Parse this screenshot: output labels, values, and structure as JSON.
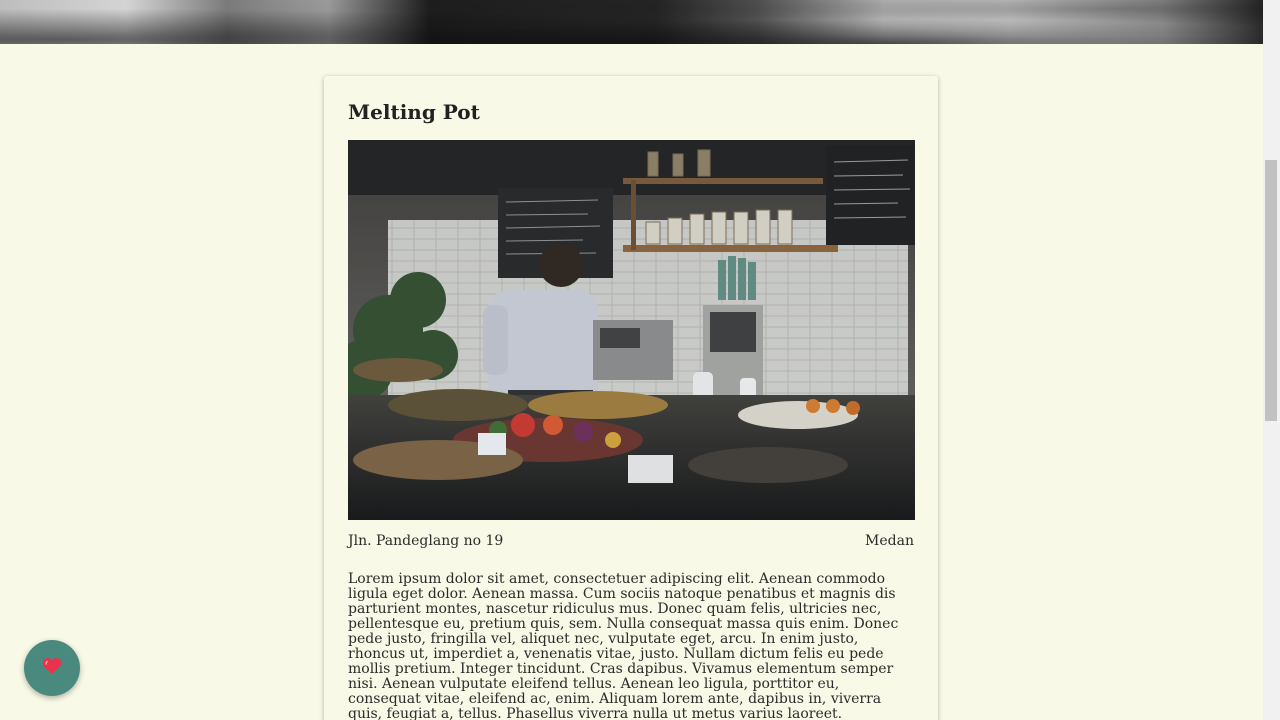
{
  "restaurant": {
    "name": "Melting Pot",
    "address": "Jln. Pandeglang no 19",
    "city": "Medan",
    "description": "Lorem ipsum dolor sit amet, consectetuer adipiscing elit. Aenean commodo ligula eget dolor. Aenean massa. Cum sociis natoque penatibus et magnis dis parturient montes, nascetur ridiculus mus. Donec quam felis, ultricies nec, pellentesque eu, pretium quis, sem. Nulla consequat massa quis enim. Donec pede justo, fringilla vel, aliquet nec, vulputate eget, arcu. In enim justo, rhoncus ut, imperdiet a, venenatis vitae, justo. Nullam dictum felis eu pede mollis pretium. Integer tincidunt. Cras dapibus. Vivamus elementum semper nisi. Aenean vulputate eleifend tellus. Aenean leo ligula, porttitor eu, consequat vitae, eleifend ac, enim. Aliquam lorem ante, dapibus in, viverra quis, feugiat a, tellus. Phasellus viverra nulla ut metus varius laoreet."
  },
  "fab": {
    "icon": "heart-icon"
  },
  "colors": {
    "background": "#f8f9e6",
    "fab": "#4a8a7e",
    "heart": "#e8334a"
  }
}
